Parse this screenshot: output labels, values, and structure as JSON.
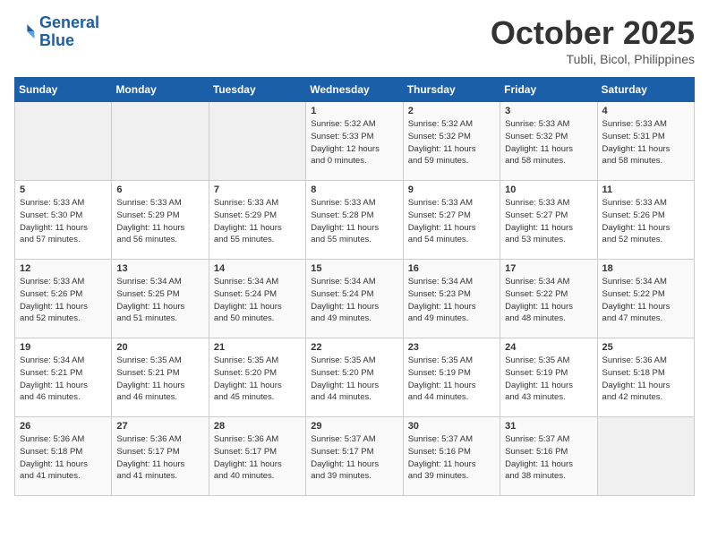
{
  "header": {
    "logo_line1": "General",
    "logo_line2": "Blue",
    "month": "October 2025",
    "location": "Tubli, Bicol, Philippines"
  },
  "weekdays": [
    "Sunday",
    "Monday",
    "Tuesday",
    "Wednesday",
    "Thursday",
    "Friday",
    "Saturday"
  ],
  "weeks": [
    [
      {
        "day": "",
        "info": ""
      },
      {
        "day": "",
        "info": ""
      },
      {
        "day": "",
        "info": ""
      },
      {
        "day": "1",
        "info": "Sunrise: 5:32 AM\nSunset: 5:33 PM\nDaylight: 12 hours\nand 0 minutes."
      },
      {
        "day": "2",
        "info": "Sunrise: 5:32 AM\nSunset: 5:32 PM\nDaylight: 11 hours\nand 59 minutes."
      },
      {
        "day": "3",
        "info": "Sunrise: 5:33 AM\nSunset: 5:32 PM\nDaylight: 11 hours\nand 58 minutes."
      },
      {
        "day": "4",
        "info": "Sunrise: 5:33 AM\nSunset: 5:31 PM\nDaylight: 11 hours\nand 58 minutes."
      }
    ],
    [
      {
        "day": "5",
        "info": "Sunrise: 5:33 AM\nSunset: 5:30 PM\nDaylight: 11 hours\nand 57 minutes."
      },
      {
        "day": "6",
        "info": "Sunrise: 5:33 AM\nSunset: 5:29 PM\nDaylight: 11 hours\nand 56 minutes."
      },
      {
        "day": "7",
        "info": "Sunrise: 5:33 AM\nSunset: 5:29 PM\nDaylight: 11 hours\nand 55 minutes."
      },
      {
        "day": "8",
        "info": "Sunrise: 5:33 AM\nSunset: 5:28 PM\nDaylight: 11 hours\nand 55 minutes."
      },
      {
        "day": "9",
        "info": "Sunrise: 5:33 AM\nSunset: 5:27 PM\nDaylight: 11 hours\nand 54 minutes."
      },
      {
        "day": "10",
        "info": "Sunrise: 5:33 AM\nSunset: 5:27 PM\nDaylight: 11 hours\nand 53 minutes."
      },
      {
        "day": "11",
        "info": "Sunrise: 5:33 AM\nSunset: 5:26 PM\nDaylight: 11 hours\nand 52 minutes."
      }
    ],
    [
      {
        "day": "12",
        "info": "Sunrise: 5:33 AM\nSunset: 5:26 PM\nDaylight: 11 hours\nand 52 minutes."
      },
      {
        "day": "13",
        "info": "Sunrise: 5:34 AM\nSunset: 5:25 PM\nDaylight: 11 hours\nand 51 minutes."
      },
      {
        "day": "14",
        "info": "Sunrise: 5:34 AM\nSunset: 5:24 PM\nDaylight: 11 hours\nand 50 minutes."
      },
      {
        "day": "15",
        "info": "Sunrise: 5:34 AM\nSunset: 5:24 PM\nDaylight: 11 hours\nand 49 minutes."
      },
      {
        "day": "16",
        "info": "Sunrise: 5:34 AM\nSunset: 5:23 PM\nDaylight: 11 hours\nand 49 minutes."
      },
      {
        "day": "17",
        "info": "Sunrise: 5:34 AM\nSunset: 5:22 PM\nDaylight: 11 hours\nand 48 minutes."
      },
      {
        "day": "18",
        "info": "Sunrise: 5:34 AM\nSunset: 5:22 PM\nDaylight: 11 hours\nand 47 minutes."
      }
    ],
    [
      {
        "day": "19",
        "info": "Sunrise: 5:34 AM\nSunset: 5:21 PM\nDaylight: 11 hours\nand 46 minutes."
      },
      {
        "day": "20",
        "info": "Sunrise: 5:35 AM\nSunset: 5:21 PM\nDaylight: 11 hours\nand 46 minutes."
      },
      {
        "day": "21",
        "info": "Sunrise: 5:35 AM\nSunset: 5:20 PM\nDaylight: 11 hours\nand 45 minutes."
      },
      {
        "day": "22",
        "info": "Sunrise: 5:35 AM\nSunset: 5:20 PM\nDaylight: 11 hours\nand 44 minutes."
      },
      {
        "day": "23",
        "info": "Sunrise: 5:35 AM\nSunset: 5:19 PM\nDaylight: 11 hours\nand 44 minutes."
      },
      {
        "day": "24",
        "info": "Sunrise: 5:35 AM\nSunset: 5:19 PM\nDaylight: 11 hours\nand 43 minutes."
      },
      {
        "day": "25",
        "info": "Sunrise: 5:36 AM\nSunset: 5:18 PM\nDaylight: 11 hours\nand 42 minutes."
      }
    ],
    [
      {
        "day": "26",
        "info": "Sunrise: 5:36 AM\nSunset: 5:18 PM\nDaylight: 11 hours\nand 41 minutes."
      },
      {
        "day": "27",
        "info": "Sunrise: 5:36 AM\nSunset: 5:17 PM\nDaylight: 11 hours\nand 41 minutes."
      },
      {
        "day": "28",
        "info": "Sunrise: 5:36 AM\nSunset: 5:17 PM\nDaylight: 11 hours\nand 40 minutes."
      },
      {
        "day": "29",
        "info": "Sunrise: 5:37 AM\nSunset: 5:17 PM\nDaylight: 11 hours\nand 39 minutes."
      },
      {
        "day": "30",
        "info": "Sunrise: 5:37 AM\nSunset: 5:16 PM\nDaylight: 11 hours\nand 39 minutes."
      },
      {
        "day": "31",
        "info": "Sunrise: 5:37 AM\nSunset: 5:16 PM\nDaylight: 11 hours\nand 38 minutes."
      },
      {
        "day": "",
        "info": ""
      }
    ]
  ]
}
